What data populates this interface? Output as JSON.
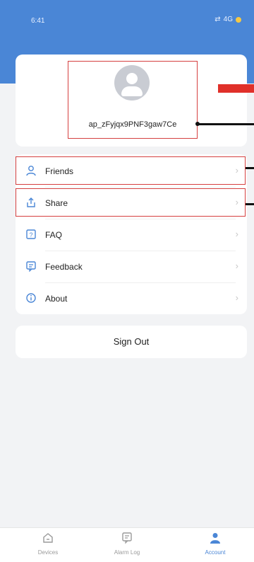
{
  "status_bar": {
    "time": "6:41",
    "network": "4G"
  },
  "profile": {
    "username": "ap_zFyjqx9PNF3gaw7Ce"
  },
  "menu": [
    {
      "label": "Friends",
      "icon": "person-icon"
    },
    {
      "label": "Share",
      "icon": "share-icon"
    },
    {
      "label": "FAQ",
      "icon": "faq-icon"
    },
    {
      "label": "Feedback",
      "icon": "feedback-icon"
    },
    {
      "label": "About",
      "icon": "info-icon"
    }
  ],
  "chevron": "›",
  "sign_out_label": "Sign Out",
  "tabs": [
    {
      "label": "Devices",
      "icon": "home-icon",
      "active": false
    },
    {
      "label": "Alarm Log",
      "icon": "alarm-log-icon",
      "active": false
    },
    {
      "label": "Account",
      "icon": "account-icon",
      "active": true
    }
  ],
  "colors": {
    "accent": "#4a86d6",
    "annotation_red": "#d54040",
    "annotation_arrow": "#e0302a"
  }
}
